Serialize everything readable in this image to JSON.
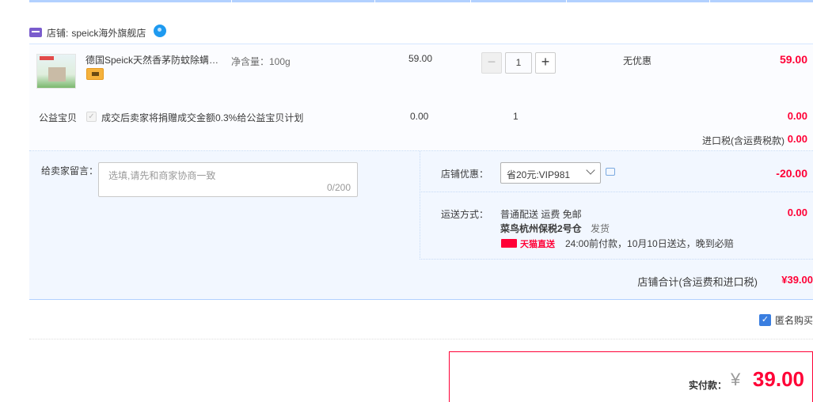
{
  "shop": {
    "label": "店铺:",
    "name": "speick海外旗舰店",
    "icon": "shop-icon",
    "chat_icon": "wangwang-icon"
  },
  "item": {
    "title": "德国Speick天然香茅防蚊除螨…",
    "sku": "净含量：100g",
    "price": "59.00",
    "quantity": "1",
    "qty_minus": "−",
    "qty_plus": "+",
    "discount": "无优惠",
    "subtotal": "59.00"
  },
  "charity": {
    "label": "公益宝贝",
    "text": "成交后卖家将捐赠成交金额0.3%给公益宝贝计划",
    "checked": true,
    "price": "0.00",
    "quantity": "1",
    "subtotal": "0.00"
  },
  "tax": {
    "label": "进口税(含运费税款)",
    "value": "0.00"
  },
  "message": {
    "label": "给卖家留言：",
    "placeholder": "选填,请先和商家协商一致",
    "count": "0/200"
  },
  "shop_discount": {
    "label": "店铺优惠：",
    "selected": "省20元:VIP981",
    "amount": "-20.00"
  },
  "shipping": {
    "label": "运送方式：",
    "method": "普通配送 运费 免邮",
    "warehouse": "菜鸟杭州保税2号仓",
    "dispatch": "发货",
    "badge": "天猫直送",
    "promise": "24:00前付款，10月10日送达，晚到必赔",
    "fee": "0.00"
  },
  "shop_total": {
    "label": "店铺合计(含运费和进口税)",
    "value": "¥39.00"
  },
  "anonymous": {
    "label": "匿名购买",
    "checked": true
  },
  "payment": {
    "label": "实付款：",
    "symbol": "¥",
    "amount": "39.00"
  },
  "colors": {
    "accent": "#ff0036",
    "primary_blue": "#3a7ee0",
    "panel_bg": "#f2f7ff"
  }
}
